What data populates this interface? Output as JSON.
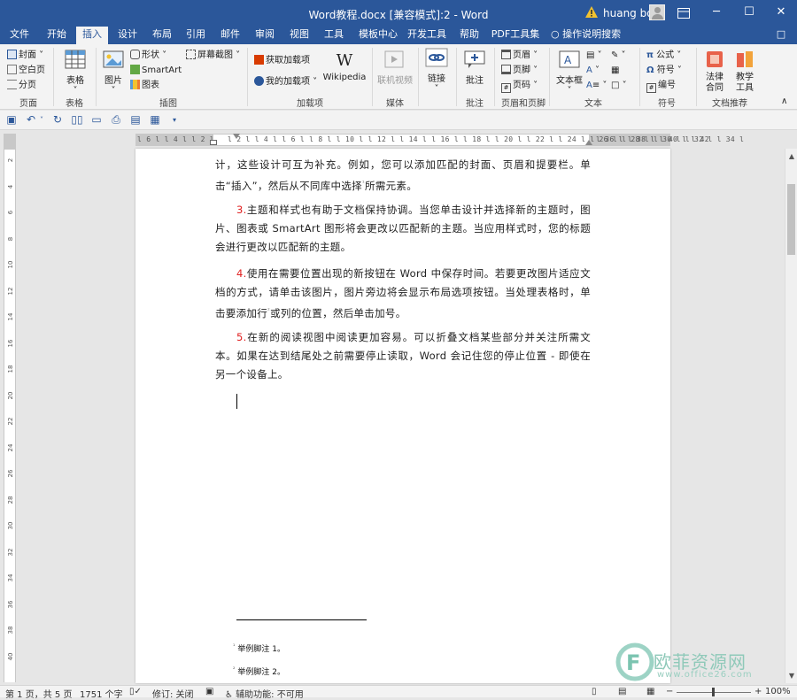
{
  "window": {
    "title": "Word教程.docx [兼容模式]:2  -  Word",
    "user": "huang bo",
    "minimize": "─",
    "restore": "☐",
    "close": "✕"
  },
  "tabs": [
    "文件",
    "开始",
    "插入",
    "设计",
    "布局",
    "引用",
    "邮件",
    "审阅",
    "视图",
    "工具",
    "模板中心",
    "开发工具",
    "帮助",
    "PDF工具集"
  ],
  "tell_me": "操作说明搜索",
  "ribbon": {
    "pages": {
      "cover": "封面",
      "blank": "空白页",
      "break": "分页",
      "label": "页面"
    },
    "tables": {
      "table": "表格",
      "label": "表格"
    },
    "illustrations": {
      "pictures": "图片",
      "shapes": "形状",
      "smartart": "SmartArt",
      "chart": "图表",
      "screenshot": "屏幕截图",
      "label": "插图"
    },
    "addins": {
      "get": "获取加载项",
      "my": "我的加载项",
      "wikipedia": "Wikipedia",
      "label": "加载项"
    },
    "media": {
      "online_video": "联机视频",
      "label": "媒体"
    },
    "links": {
      "link": "链接"
    },
    "comments": {
      "comment": "批注",
      "label": "批注"
    },
    "header_footer": {
      "header": "页眉",
      "footer": "页脚",
      "page_number": "页码",
      "label": "页眉和页脚"
    },
    "text": {
      "textbox": "文本框",
      "label": "文本"
    },
    "symbols": {
      "equation": "公式",
      "symbol": "符号",
      "numbering": "编号",
      "label": "符号"
    },
    "docs": {
      "legal": "法律\n合同",
      "teaching": "教学\n工具",
      "label": "文档推荐"
    }
  },
  "ruler": {
    "h_left": "l 6 l  l 4 l  l 2 l",
    "h_main": "l 2 l  l 4 l  l 6 l  l 8 l  l 10 l  l 12 l  l 14 l  l 16 l  l 18 l  l 20 l  l 22 l  l 24 l  l 26 l  l 28 l  l 30 l  l 32 l  l 34 l",
    "h_right": "l 36 l  l 38 l  l 40 l  l 42",
    "v_numbers": [
      "2",
      "4",
      "6",
      "8",
      "10",
      "12",
      "14",
      "16",
      "18",
      "20",
      "22",
      "24",
      "26",
      "28",
      "30",
      "32",
      "34",
      "36",
      "38",
      "40"
    ]
  },
  "document": {
    "p1": "计，这些设计可互为补充。例如，您可以添加匹配的封面、页眉和提要栏。单击“插入”，然后从不同库中选择",
    "p1_sup": "¹",
    "p1_end": "所需元素。",
    "p2_num": "3.",
    "p2": "主题和样式也有助于文档保持协调。当您单击设计并选择新的主题时，图片、图表或 SmartArt 图形将会更改以匹配新的主题。当应用样式时，您的标题会进行更改以匹配新的主题。",
    "p3_num": "4.",
    "p3": "使用在需要位置出现的新按钮在 Word 中保存时间。若要更改图片适应文档的方式，请单击该图片，图片旁边将会显示布局选项按钮。当处理表格时，单击要添加行",
    "p3_sup": "²",
    "p3_end": "或列的位置，然后单击加号。",
    "p4_num": "5.",
    "p4": "在新的阅读视图中阅读更加容易。可以折叠文档某些部分并关注所需文本。如果在达到结尾处之前需要停止读取，Word 会记住您的停止位置 - 即使在另一个设备上。",
    "footnote1_mark": "¹",
    "footnote1": "举例脚注 1。",
    "footnote2_mark": "²",
    "footnote2": "举例脚注 2。"
  },
  "status": {
    "page": "第 1 页，共 5 页",
    "words": "1751 个字",
    "track": "修订: 关闭",
    "accessibility": "辅助功能: 不可用",
    "zoom": "100%"
  },
  "watermark": {
    "name": "欧菲资源网",
    "url": "www.office26.com"
  },
  "colors": {
    "accent": "#2b579a",
    "red": "#e02020"
  }
}
